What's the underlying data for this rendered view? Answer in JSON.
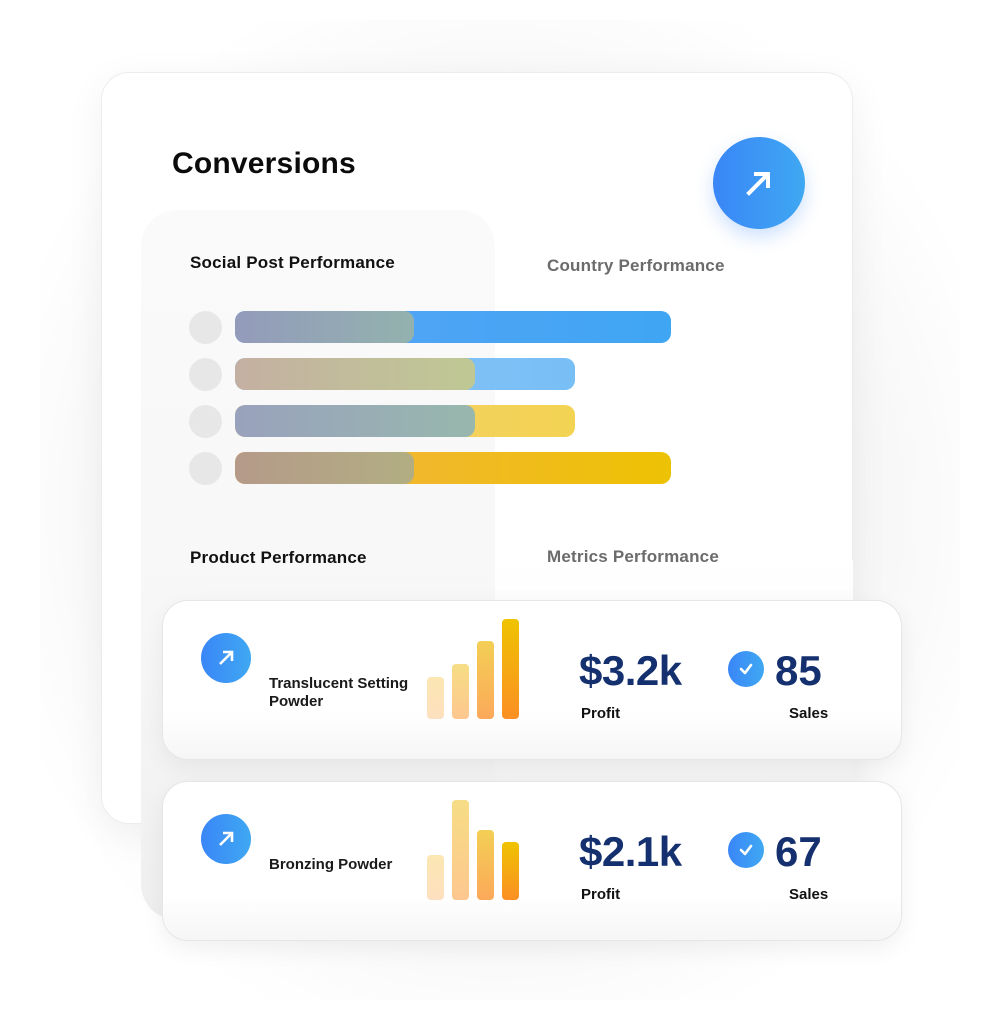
{
  "header": {
    "title": "Conversions",
    "action_icon": "arrow-up-right-icon",
    "accent_gradient": [
      "#3a86f7",
      "#3fa8f2"
    ]
  },
  "sections": {
    "social_post": "Social Post Performance",
    "country": "Country Performance",
    "product": "Product  Performance",
    "metrics": "Metrics Performance"
  },
  "performance_bars": [
    {
      "fill": 1.0,
      "overlay": 0.41,
      "color_start": "#5aa2f7",
      "color_end": "#3fa6f3",
      "overlay_start": "#939bbb",
      "overlay_end": "#93b2ae"
    },
    {
      "fill": 0.78,
      "overlay": 0.55,
      "color_start": "#8cc4f5",
      "color_end": "#78bff6",
      "overlay_start": "#c4b0a2",
      "overlay_end": "#bfc894"
    },
    {
      "fill": 0.78,
      "overlay": 0.55,
      "color_start": "#f3cd72",
      "color_end": "#f3d352",
      "overlay_start": "#99a2bd",
      "overlay_end": "#98b7ad"
    },
    {
      "fill": 1.0,
      "overlay": 0.41,
      "color_start": "#f4b14a",
      "color_end": "#edc203",
      "overlay_start": "#b59a8a",
      "overlay_end": "#b2ae82"
    }
  ],
  "products": [
    {
      "name": "Translucent Setting Powder",
      "icon": "arrow-up-right-icon",
      "trend_bars": [
        0.42,
        0.55,
        0.78,
        1.0
      ],
      "profit_value": "$3.2k",
      "profit_label": "Profit",
      "sales_value": "85",
      "sales_label": "Sales",
      "sales_icon": "check-circle-icon"
    },
    {
      "name": "Bronzing Powder",
      "icon": "arrow-up-right-icon",
      "trend_bars": [
        0.45,
        1.0,
        0.7,
        0.58
      ],
      "profit_value": "$2.1k",
      "profit_label": "Profit",
      "sales_value": "67",
      "sales_label": "Sales",
      "sales_icon": "check-circle-icon"
    }
  ]
}
